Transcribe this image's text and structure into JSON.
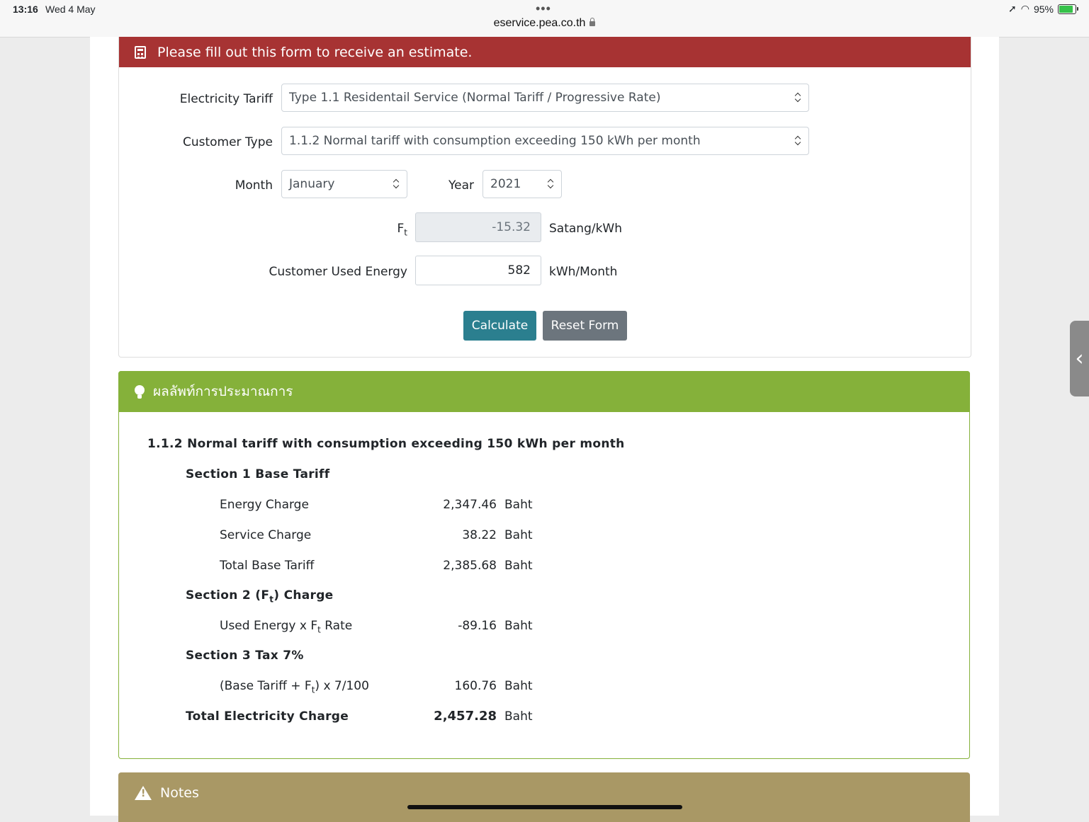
{
  "statusbar": {
    "time": "13:16",
    "date": "Wed 4 May",
    "url": "eservice.pea.co.th",
    "battery": "95%"
  },
  "form": {
    "header": "Please fill out this form to receive an estimate.",
    "tariff_label": "Electricity Tariff",
    "tariff_value": "Type 1.1 Residentail Service (Normal Tariff / Progressive Rate)",
    "customer_type_label": "Customer Type",
    "customer_type_value": "1.1.2 Normal tariff with consumption exceeding 150 kWh per month",
    "month_label": "Month",
    "month_value": "January",
    "year_label": "Year",
    "year_value": "2021",
    "ft_label_main": "F",
    "ft_label_sub": "t",
    "ft_value": "-15.32",
    "ft_unit": "Satang/kWh",
    "energy_label": "Customer Used Energy",
    "energy_value": "582",
    "energy_unit": "kWh/Month",
    "calculate_label": "Calculate",
    "reset_label": "Reset Form"
  },
  "result": {
    "header": "ผลลัพท์การประมาณการ",
    "title": "1.1.2 Normal tariff with consumption exceeding 150 kWh per month",
    "section1": "Section 1 Base Tariff",
    "energy_charge_label": "Energy Charge",
    "energy_charge_value": "2,347.46",
    "service_charge_label": "Service Charge",
    "service_charge_value": "38.22",
    "total_base_label": "Total Base Tariff",
    "total_base_value": "2,385.68",
    "section2_pre": "Section 2 (F",
    "section2_sub": "t",
    "section2_post": ") Charge",
    "used_energy_pre": "Used Energy x F",
    "used_energy_sub": "t",
    "used_energy_post": " Rate",
    "used_energy_value": "-89.16",
    "section3": "Section 3 Tax 7%",
    "tax_pre": "(Base Tariff + F",
    "tax_sub": "t",
    "tax_post": ") x 7/100",
    "tax_value": "160.76",
    "total_label": "Total Electricity Charge",
    "total_value": "2,457.28",
    "unit": "Baht"
  },
  "notes": {
    "title": "Notes"
  }
}
